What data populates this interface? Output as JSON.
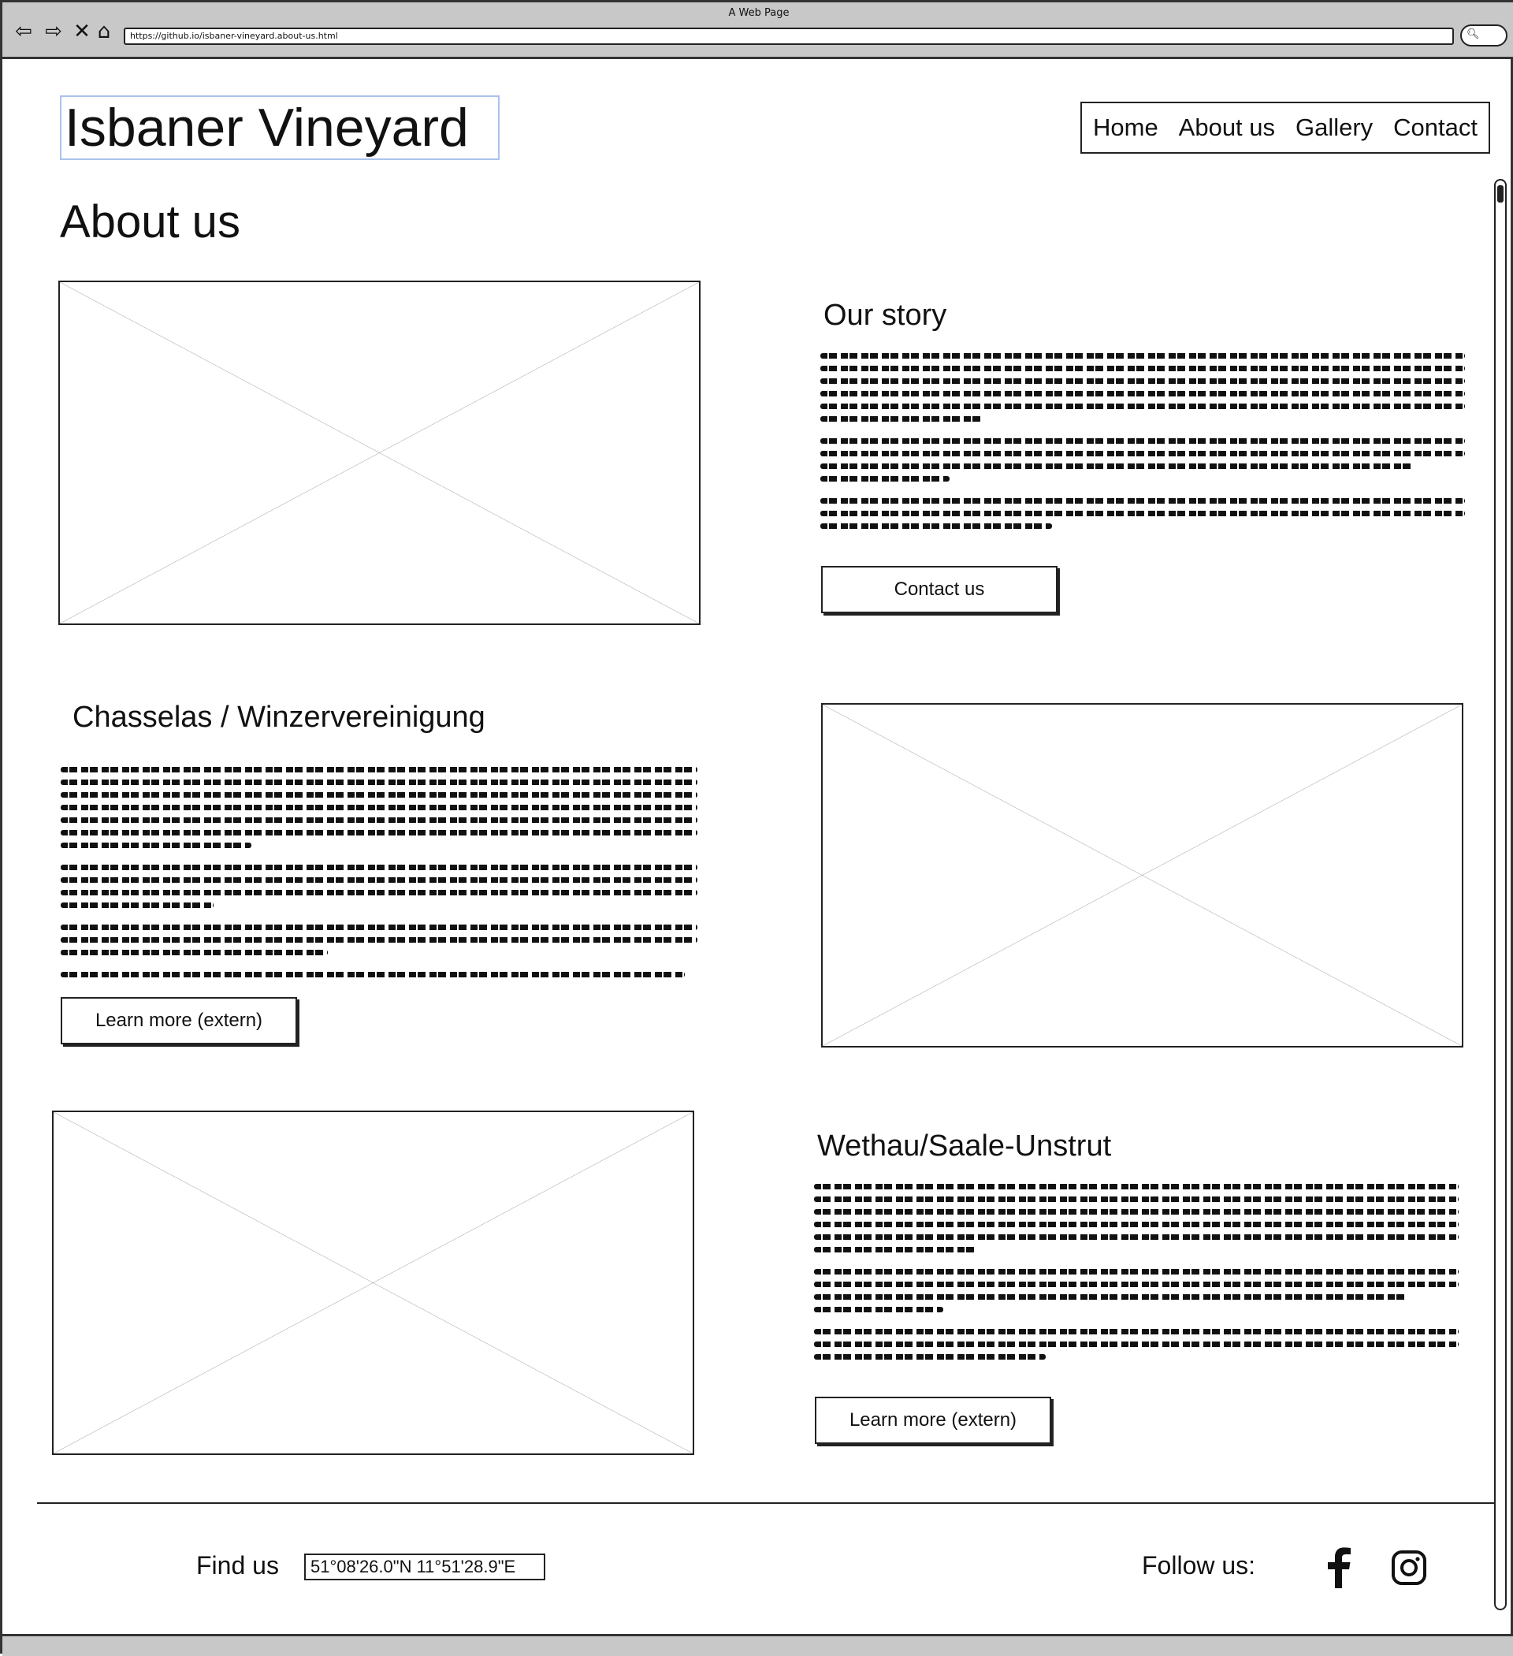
{
  "browser": {
    "window_title": "A Web Page",
    "url": "https://github.io/isbaner-vineyard.about-us.html"
  },
  "header": {
    "site_title": "Isbaner Vineyard",
    "nav": [
      "Home",
      "About us",
      "Gallery",
      "Contact"
    ]
  },
  "page": {
    "heading": "About us"
  },
  "sections": [
    {
      "title": "Our story",
      "button": "Contact us"
    },
    {
      "title": "Chasselas / Winzervereinigung",
      "button": "Learn more (extern)"
    },
    {
      "title": "Wethau/Saale-Unstrut",
      "button": "Learn more (extern)"
    }
  ],
  "footer": {
    "find_us_label": "Find us",
    "coordinates": "51°08'26.0\"N 11°51'28.9\"E",
    "follow_label": "Follow us:",
    "social": [
      "facebook-icon",
      "instagram-icon"
    ]
  }
}
